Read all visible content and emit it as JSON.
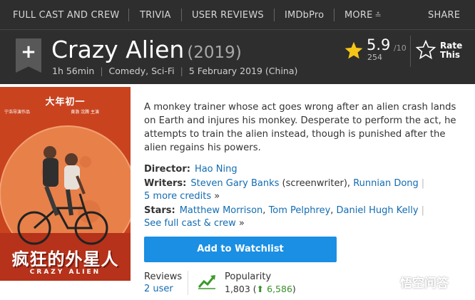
{
  "subnav": {
    "items": [
      "FULL CAST AND CREW",
      "TRIVIA",
      "USER REVIEWS",
      "IMDbPro",
      "MORE",
      "SHARE"
    ]
  },
  "movie": {
    "title": "Crazy Alien",
    "year": "(2019)",
    "runtime": "1h 56min",
    "genres": "Comedy, Sci-Fi",
    "release": "5 February 2019 (China)"
  },
  "rating": {
    "value": "5.9",
    "max": "/10",
    "count": "254",
    "rate_label_1": "Rate",
    "rate_label_2": "This"
  },
  "poster": {
    "top_text": "大年初一",
    "side_text": "宁浩导演作品",
    "cast_text": "黄渤 沈腾 主演",
    "big_title": "疯狂的外星人",
    "english_title": "CRAZY ALIEN"
  },
  "plot": "A monkey trainer whose act goes wrong after an alien crash lands on Earth and injures his monkey. Desperate to perform the act, he attempts to train the alien instead, though is punished after the alien regains his powers.",
  "credits": {
    "director_label": "Director:",
    "director": "Hao Ning",
    "writers_label": "Writers:",
    "writer1": "Steven Gary Banks",
    "writer1_role": "(screenwriter),",
    "writer2": "Runnian Dong",
    "more_credits": "5 more credits",
    "stars_label": "Stars:",
    "star1": "Matthew Morrison",
    "star2": "Tom Pelphrey",
    "star3": "Daniel Hugh Kelly",
    "full_cast": "See full cast & crew"
  },
  "watchlist_label": "Add to Watchlist",
  "reviews": {
    "title": "Reviews",
    "link": "2 user"
  },
  "popularity": {
    "title": "Popularity",
    "value": "1,803",
    "change": "6,586"
  },
  "watermark": "悟空问答",
  "colors": {
    "header": "#2e2e2e",
    "star": "#f5c518",
    "link": "#136cb2",
    "button": "#1a8fe3",
    "up": "#3b8f2a"
  }
}
